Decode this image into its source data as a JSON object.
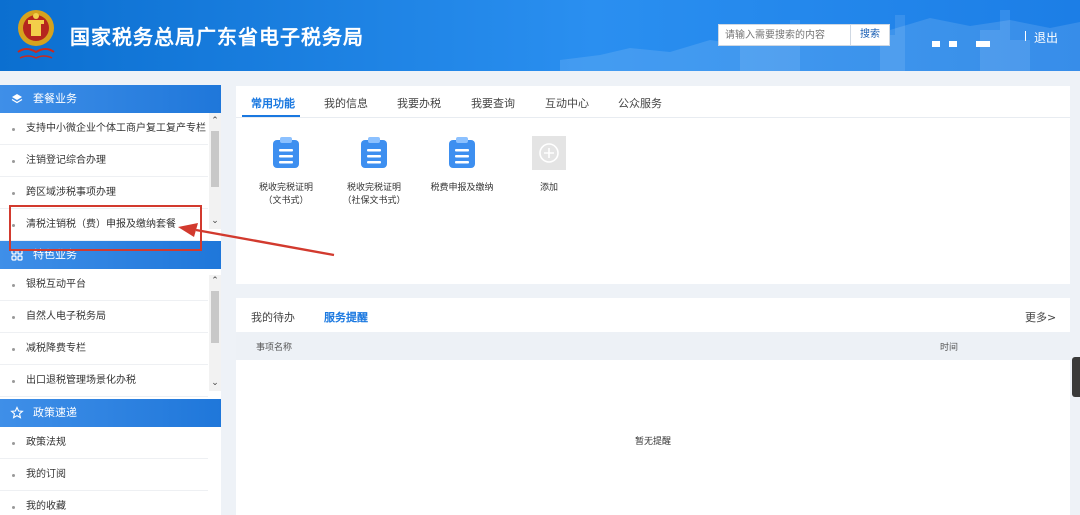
{
  "header": {
    "title": "国家税务总局广东省电子税务局",
    "search_placeholder": "请输入需要搜索的内容",
    "search_label": "搜索",
    "logout_label": "退出"
  },
  "sidebar": {
    "sections": [
      {
        "title": "套餐业务",
        "items": [
          "支持中小微企业个体工商户复工复产专栏",
          "注销登记综合办理",
          "跨区域涉税事项办理",
          "清税注销税（费）申报及缴纳套餐"
        ]
      },
      {
        "title": "特色业务",
        "items": [
          "银税互动平台",
          "自然人电子税务局",
          "减税降费专栏",
          "出口退税管理场景化办税"
        ]
      },
      {
        "title": "政策速递",
        "items": [
          "政策法规",
          "我的订阅",
          "我的收藏"
        ]
      }
    ]
  },
  "functions": {
    "tabs": [
      "常用功能",
      "我的信息",
      "我要办税",
      "我要查询",
      "互动中心",
      "公众服务"
    ],
    "active_tab": "常用功能",
    "tiles": [
      {
        "line1": "税收完税证明",
        "line2": "（文书式）",
        "icon": "document-icon"
      },
      {
        "line1": "税收完税证明",
        "line2": "（社保文书式）",
        "icon": "document-icon"
      },
      {
        "line1": "税费申报及缴纳",
        "line2": "",
        "icon": "document-icon"
      },
      {
        "line1": "添加",
        "line2": "",
        "icon": "plus-icon"
      }
    ]
  },
  "tasks": {
    "tabs": [
      "我的待办",
      "服务提醒"
    ],
    "active_tab": "服务提醒",
    "more_label": "更多>",
    "col_name": "事项名称",
    "col_time": "时间",
    "empty_text": "暂无提醒"
  },
  "colors": {
    "header_blue": "#1c7ee6",
    "accent": "#1a78e0",
    "annotation_red": "#d23a2e"
  }
}
